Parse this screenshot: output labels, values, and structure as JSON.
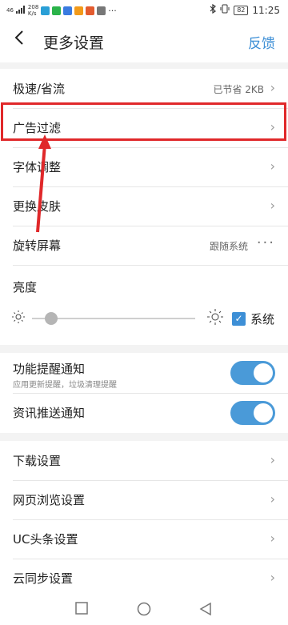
{
  "status_bar": {
    "signal": "46",
    "net_speed_value": "208",
    "net_speed_unit": "K/s",
    "battery": "82",
    "time": "11:25"
  },
  "header": {
    "back_icon": "back-icon",
    "title": "更多设置",
    "feedback": "反馈"
  },
  "rows": {
    "speed_saver": {
      "label": "极速/省流",
      "value": "已节省 2KB"
    },
    "ad_filter": {
      "label": "广告过滤"
    },
    "font_adjust": {
      "label": "字体调整"
    },
    "skin": {
      "label": "更换皮肤"
    },
    "rotate": {
      "label": "旋转屏幕",
      "value": "跟随系统"
    },
    "brightness": {
      "label": "亮度",
      "level": 0.12,
      "system_checked": true,
      "system_label": "系统"
    }
  },
  "toggles": {
    "feature_reminder": {
      "label": "功能提醒通知",
      "sub": "应用更新提醒，垃圾清理提醒",
      "on": true
    },
    "news_push": {
      "label": "资讯推送通知",
      "on": true
    }
  },
  "more": {
    "download": "下载设置",
    "web_browse": "网页浏览设置",
    "uc_headlines": "UC头条设置",
    "cloud_sync": "云同步设置"
  },
  "colors": {
    "accent": "#3d8fd6",
    "toggle_on": "#4a9ad8",
    "annotation": "#e0282a"
  }
}
